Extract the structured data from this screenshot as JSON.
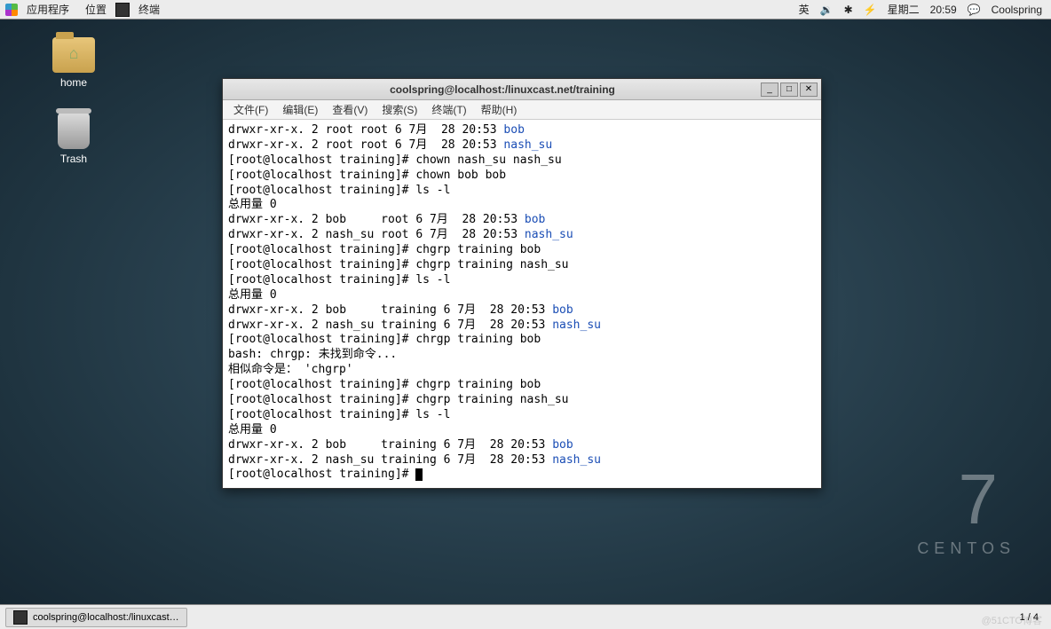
{
  "top_panel": {
    "apps": "应用程序",
    "places": "位置",
    "task_label": "终端",
    "input": "英",
    "day": "星期二",
    "time": "20:59",
    "user": "Coolspring"
  },
  "desktop": {
    "home": "home",
    "trash": "Trash",
    "brand7": "7",
    "brand_centos": "CENTOS"
  },
  "terminal": {
    "title": "coolspring@localhost:/linuxcast.net/training",
    "menu": {
      "file": "文件(F)",
      "edit": "编辑(E)",
      "view": "查看(V)",
      "search": "搜索(S)",
      "terminal": "终端(T)",
      "help": "帮助(H)"
    },
    "win": {
      "min": "_",
      "max": "□",
      "close": "✕"
    },
    "lines": {
      "l01a": "drwxr-xr-x. 2 root root 6 7月  28 20:53 ",
      "l01b": "bob",
      "l02a": "drwxr-xr-x. 2 root root 6 7月  28 20:53 ",
      "l02b": "nash_su",
      "l03": "[root@localhost training]# chown nash_su nash_su",
      "l04": "[root@localhost training]# chown bob bob",
      "l05": "[root@localhost training]# ls -l",
      "l06": "总用量 0",
      "l07a": "drwxr-xr-x. 2 bob     root 6 7月  28 20:53 ",
      "l07b": "bob",
      "l08a": "drwxr-xr-x. 2 nash_su root 6 7月  28 20:53 ",
      "l08b": "nash_su",
      "l09": "[root@localhost training]# chgrp training bob",
      "l10": "[root@localhost training]# chgrp training nash_su",
      "l11": "[root@localhost training]# ls -l",
      "l12": "总用量 0",
      "l13a": "drwxr-xr-x. 2 bob     training 6 7月  28 20:53 ",
      "l13b": "bob",
      "l14a": "drwxr-xr-x. 2 nash_su training 6 7月  28 20:53 ",
      "l14b": "nash_su",
      "l15": "[root@localhost training]# chrgp training bob",
      "l16": "bash: chrgp: 未找到命令...",
      "l17": "相似命令是： 'chgrp'",
      "l18": "[root@localhost training]# chgrp training bob",
      "l19": "[root@localhost training]# chgrp training nash_su",
      "l20": "[root@localhost training]# ls -l",
      "l21": "总用量 0",
      "l22a": "drwxr-xr-x. 2 bob     training 6 7月  28 20:53 ",
      "l22b": "bob",
      "l23a": "drwxr-xr-x. 2 nash_su training 6 7月  28 20:53 ",
      "l23b": "nash_su",
      "l24": "[root@localhost training]# "
    }
  },
  "bottom": {
    "task": "coolspring@localhost:/linuxcast…",
    "workspace": "1 / 4"
  },
  "watermark": "@51CTO博客"
}
